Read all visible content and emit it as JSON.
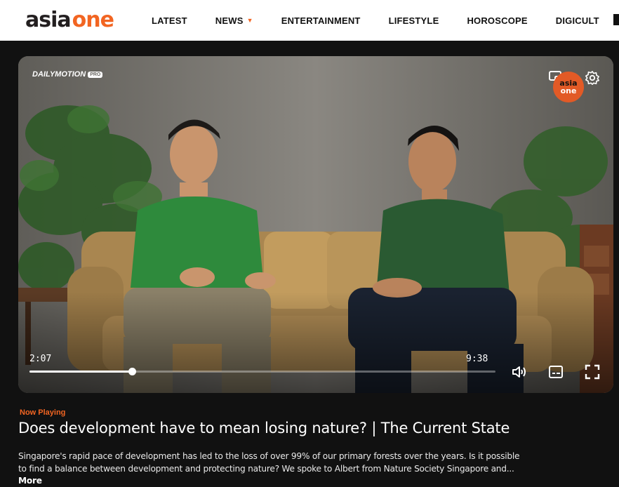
{
  "header": {
    "logo_part1": "asia",
    "logo_part2": "one",
    "nav": [
      {
        "label": "LATEST"
      },
      {
        "label": "NEWS"
      },
      {
        "label": "ENTERTAINMENT"
      },
      {
        "label": "LIFESTYLE"
      },
      {
        "label": "HOROSCOPE"
      },
      {
        "label": "DIGICULT"
      }
    ]
  },
  "player": {
    "brand": "DAILYMOTION",
    "brand_badge": "PRO",
    "channel_badge_top": "asia",
    "channel_badge_bottom": "one",
    "current_time": "2:07",
    "total_time": "9:38",
    "progress": 0.22,
    "icons": [
      "cast-icon",
      "settings-icon",
      "volume-icon",
      "subtitles-icon",
      "fullscreen-icon"
    ]
  },
  "video_info": {
    "now_playing": "Now Playing",
    "title": "Does development have to mean losing nature? | The Current State",
    "description_line1": "Singapore's rapid pace of development has led to the loss of over 99% of our primary forests over the years. Is it possible",
    "description_line2": "to find a balance between development and protecting nature? We spoke to Albert from Nature Society Singapore and...",
    "more_label": "More"
  },
  "colors": {
    "accent": "#f26522",
    "background": "#111111",
    "nav_bg": "#ffffff"
  }
}
